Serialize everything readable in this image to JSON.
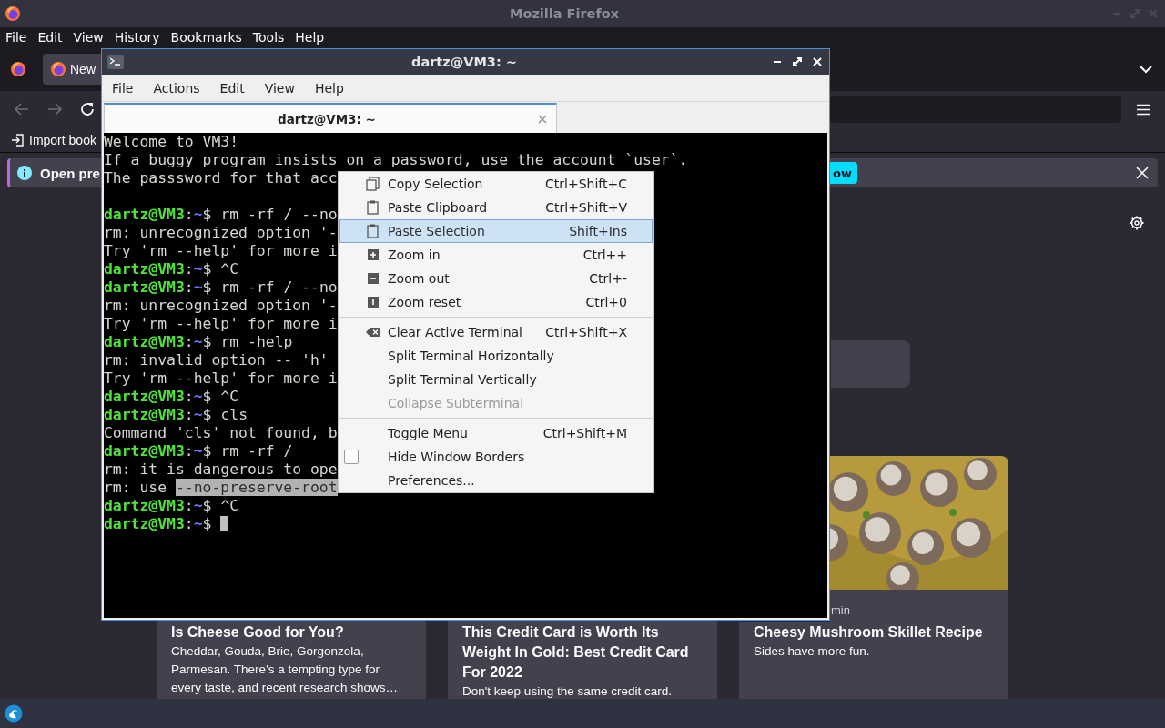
{
  "browser": {
    "title": "Mozilla Firefox",
    "menu": [
      "File",
      "Edit",
      "View",
      "History",
      "Bookmarks",
      "Tools",
      "Help"
    ],
    "tab": {
      "label": "New",
      "selected": true
    },
    "bookmark": "Import book",
    "notification": {
      "text": "Open pre",
      "button": "ow"
    },
    "cards": [
      {
        "title": "Is Cheese Good for You?",
        "description": "Cheddar, Gouda, Brie, Gorgonzola, Parmesan. There’s a tempting type for every taste, and recent research shows…"
      },
      {
        "title": "This Credit Card is Worth Its Weight In Gold: Best Credit Card For 2022",
        "description": "Don't keep using the same credit card."
      },
      {
        "meta": "min",
        "title": "Cheesy Mushroom Skillet Recipe",
        "description": "Sides have more fun."
      }
    ]
  },
  "terminal": {
    "title": "dartz@VM3: ~",
    "menu": [
      "File",
      "Actions",
      "Edit",
      "View",
      "Help"
    ],
    "tab": {
      "label": "dartz@VM3: ~",
      "selected": true
    },
    "lines": [
      {
        "kind": "output",
        "text": "Welcome to VM3!"
      },
      {
        "kind": "output",
        "text": "If a buggy program insists on a password, use the account `user`."
      },
      {
        "kind": "output",
        "text": "The passsword for that acc"
      },
      {
        "kind": "blank"
      },
      {
        "kind": "prompt",
        "host": "dartz@VM3",
        "sep": ":",
        "path": "~",
        "symbol": "$",
        "command": "rm -rf / --no"
      },
      {
        "kind": "output",
        "text": "rm: unrecognized option '-"
      },
      {
        "kind": "output",
        "text": "Try 'rm --help' for more i"
      },
      {
        "kind": "prompt",
        "host": "dartz@VM3",
        "sep": ":",
        "path": "~",
        "symbol": "$",
        "command": "^C"
      },
      {
        "kind": "prompt",
        "host": "dartz@VM3",
        "sep": ":",
        "path": "~",
        "symbol": "$",
        "command": "rm -rf / --no"
      },
      {
        "kind": "output",
        "text": "rm: unrecognized option '-"
      },
      {
        "kind": "output",
        "text": "Try 'rm --help' for more i"
      },
      {
        "kind": "prompt",
        "host": "dartz@VM3",
        "sep": ":",
        "path": "~",
        "symbol": "$",
        "command": "rm -help"
      },
      {
        "kind": "output",
        "text": "rm: invalid option -- 'h'"
      },
      {
        "kind": "output",
        "text": "Try 'rm --help' for more i"
      },
      {
        "kind": "prompt",
        "host": "dartz@VM3",
        "sep": ":",
        "path": "~",
        "symbol": "$",
        "command": "^C"
      },
      {
        "kind": "prompt",
        "host": "dartz@VM3",
        "sep": ":",
        "path": "~",
        "symbol": "$",
        "command": "cls"
      },
      {
        "kind": "output",
        "text": "Command 'cls' not found, b"
      },
      {
        "kind": "prompt",
        "host": "dartz@VM3",
        "sep": ":",
        "path": "~",
        "symbol": "$",
        "command": "rm -rf /"
      },
      {
        "kind": "output",
        "text": "rm: it is dangerous to ope"
      },
      {
        "kind": "output",
        "text": "rm: use ",
        "selection": "--no-preserve-root"
      },
      {
        "kind": "prompt",
        "host": "dartz@VM3",
        "sep": ":",
        "path": "~",
        "symbol": "$",
        "command": "^C"
      },
      {
        "kind": "prompt",
        "host": "dartz@VM3",
        "sep": ":",
        "path": "~",
        "symbol": "$",
        "cursor": true
      }
    ]
  },
  "context_menu": [
    {
      "kind": "item",
      "label": "Copy Selection",
      "shortcut": "Ctrl+Shift+C",
      "selected": false,
      "disabled": false
    },
    {
      "kind": "item",
      "label": "Paste Clipboard",
      "shortcut": "Ctrl+Shift+V",
      "selected": false,
      "disabled": false
    },
    {
      "kind": "item",
      "label": "Paste Selection",
      "shortcut": "Shift+Ins",
      "selected": true,
      "disabled": false
    },
    {
      "kind": "item",
      "label": "Zoom in",
      "shortcut": "Ctrl++",
      "selected": false,
      "disabled": false
    },
    {
      "kind": "item",
      "label": "Zoom out",
      "shortcut": "Ctrl+-",
      "selected": false,
      "disabled": false
    },
    {
      "kind": "item",
      "label": "Zoom reset",
      "shortcut": "Ctrl+0",
      "selected": false,
      "disabled": false
    },
    {
      "kind": "separator"
    },
    {
      "kind": "item",
      "label": "Clear Active Terminal",
      "shortcut": "Ctrl+Shift+X",
      "selected": false,
      "disabled": false
    },
    {
      "kind": "item",
      "label": "Split Terminal Horizontally",
      "selected": false,
      "disabled": false
    },
    {
      "kind": "item",
      "label": "Split Terminal Vertically",
      "selected": false,
      "disabled": false
    },
    {
      "kind": "item",
      "label": "Collapse Subterminal",
      "selected": false,
      "disabled": true
    },
    {
      "kind": "separator"
    },
    {
      "kind": "item",
      "label": "Toggle Menu",
      "shortcut": "Ctrl+Shift+M",
      "selected": false,
      "disabled": false
    },
    {
      "kind": "check",
      "label": "Hide Window Borders",
      "checked": false,
      "selected": false,
      "disabled": false
    },
    {
      "kind": "item",
      "label": "Preferences...",
      "selected": false,
      "disabled": false
    }
  ]
}
